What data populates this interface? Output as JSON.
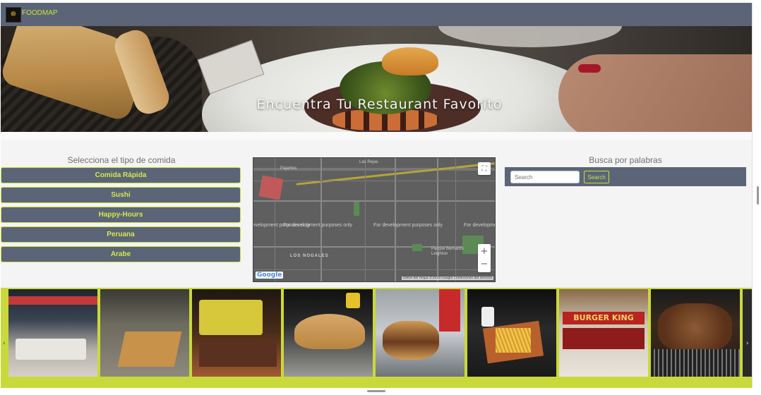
{
  "navbar": {
    "brand": "FOODMAP",
    "logo_icon": "foodmap-logo-icon"
  },
  "hero": {
    "title": "Encuentra Tu Restaurant Favorito"
  },
  "categories": {
    "heading": "Selecciona el tipo de comida",
    "items": [
      {
        "label": "Comida Rápida"
      },
      {
        "label": "Sushi"
      },
      {
        "label": "Happy-Hours"
      },
      {
        "label": "Peruana"
      },
      {
        "label": "Arabe"
      }
    ]
  },
  "map": {
    "dev_text": "For development purposes only",
    "labels": [
      "Pajaritos",
      "Las Rejas",
      "LOS NOGALES",
      "Parque Bernardo Leighton"
    ],
    "attribution": "Datos del mapa ©2018 Google   Condiciones del servicio",
    "google": "Google",
    "zoom_in": "+",
    "zoom_out": "−",
    "fullscreen_icon": "fullscreen-icon"
  },
  "search": {
    "heading": "Busca por palabras",
    "placeholder": "Search",
    "button": "Search"
  },
  "carousel": {
    "prev": "‹",
    "next": "›",
    "images": [
      "food-court",
      "restaurant-tables",
      "food-truck",
      "burger-plate",
      "burger-wrapped",
      "fries-tray",
      "burger-king-storefront",
      "grilled-meat"
    ]
  },
  "colors": {
    "navbar": "#5b6577",
    "accent": "#c8e03a",
    "carousel_bg": "#c9d93b"
  }
}
